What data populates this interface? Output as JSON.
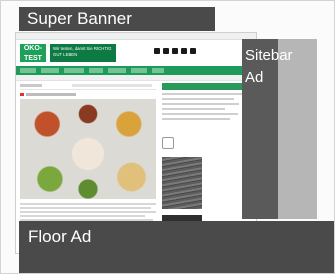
{
  "ads": {
    "super_banner_label": "Super Banner",
    "sitebar_label_line1": "Sitebar",
    "sitebar_label_line2": "Ad",
    "floor_label": "Floor Ad"
  },
  "site": {
    "logo_name": "ÖKO-TEST",
    "claim_text": "Wir testen, damit Sie RICHTIG GUT LEBEN"
  },
  "colors": {
    "ad_fill": "#4a4a4a",
    "sitebar_light": "#b6b6b6",
    "brand_green": "#1ea05a"
  }
}
